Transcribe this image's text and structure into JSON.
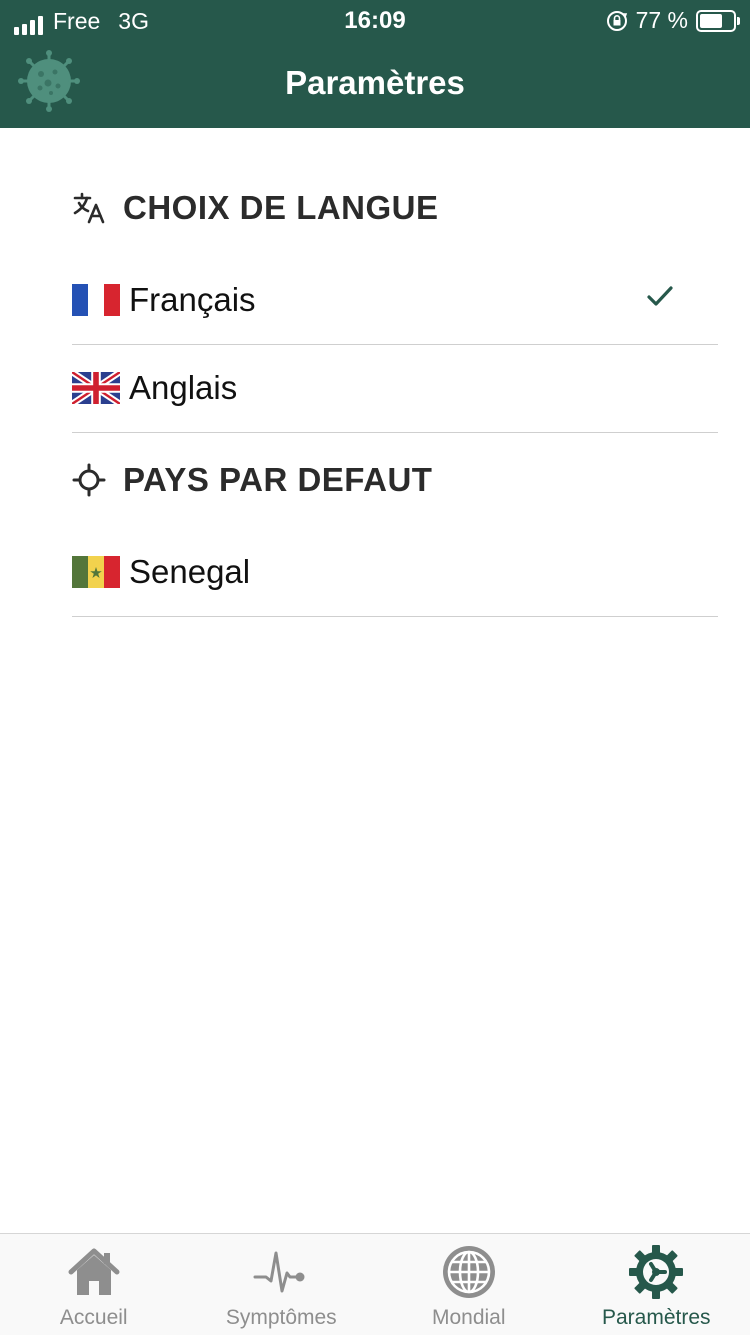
{
  "status_bar": {
    "carrier": "Free",
    "network": "3G",
    "time": "16:09",
    "battery_text": "77 %",
    "battery_level": 0.77
  },
  "header": {
    "title": "Paramètres",
    "logo_icon": "virus-icon"
  },
  "language_section": {
    "title": "CHOIX DE LANGUE",
    "icon": "translate-icon",
    "options": [
      {
        "label": "Français",
        "flag": "france-flag",
        "selected": true
      },
      {
        "label": "Anglais",
        "flag": "uk-flag",
        "selected": false
      }
    ]
  },
  "country_section": {
    "title": "PAYS PAR DEFAUT",
    "icon": "location-crosshair-icon",
    "options": [
      {
        "label": "Senegal",
        "flag": "senegal-flag"
      }
    ]
  },
  "tabbar": {
    "tabs": [
      {
        "label": "Accueil",
        "icon": "home-icon",
        "active": false
      },
      {
        "label": "Symptômes",
        "icon": "pulse-icon",
        "active": false
      },
      {
        "label": "Mondial",
        "icon": "globe-icon",
        "active": false
      },
      {
        "label": "Paramètres",
        "icon": "gear-icon",
        "active": true
      }
    ]
  },
  "colors": {
    "primary": "#26584b",
    "inactive": "#8e8e8e",
    "divider": "#cfcfcf"
  }
}
